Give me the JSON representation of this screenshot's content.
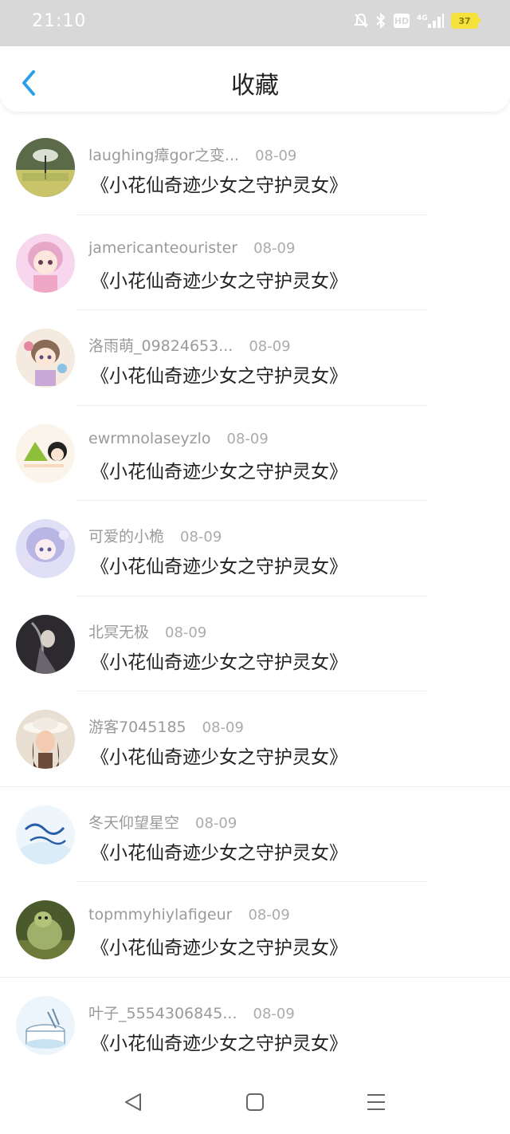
{
  "status_bar": {
    "time": "21:10",
    "network": "4G",
    "hd": "HD",
    "battery": "37",
    "icons": [
      "mute-bell-icon",
      "bluetooth-icon",
      "hd-icon",
      "signal-icon",
      "battery-icon"
    ]
  },
  "header": {
    "title": "收藏",
    "back_icon": "chevron-left-icon",
    "accent": "#2aa0e6"
  },
  "favorites": [
    {
      "user": "laughing瘴gor之变...",
      "date": "08-09",
      "title": "《小花仙奇迹少女之守护灵女》",
      "avatar": "girl-umbrella-photo"
    },
    {
      "user": "jamericanteourister",
      "date": "08-09",
      "title": "《小花仙奇迹少女之守护灵女》",
      "avatar": "pink-anime-girl"
    },
    {
      "user": "洛雨萌_09824653...",
      "date": "08-09",
      "title": "《小花仙奇迹少女之守护灵女》",
      "avatar": "anime-girl-sweets"
    },
    {
      "user": "ewrmnolaseyzlo",
      "date": "08-09",
      "title": "《小花仙奇迹少女之守护灵女》",
      "avatar": "cartoon-zongzi-couple"
    },
    {
      "user": "可爱的小桅",
      "date": "08-09",
      "title": "《小花仙奇迹少女之守护灵女》",
      "avatar": "purple-anime-girl"
    },
    {
      "user": "北冥无极",
      "date": "08-09",
      "title": "《小花仙奇迹少女之守护灵女》",
      "avatar": "dark-ink-warrior"
    },
    {
      "user": "游客7045185",
      "date": "08-09",
      "title": "《小花仙奇迹少女之守护灵女》",
      "avatar": "girl-with-hat-photo"
    },
    {
      "user": "冬天仰望星空",
      "date": "08-09",
      "title": "《小花仙奇迹少女之守护灵女》",
      "avatar": "blue-calligraphy"
    },
    {
      "user": "topmmyhiylafigeur",
      "date": "08-09",
      "title": "《小花仙奇迹少女之守护灵女》",
      "avatar": "green-ogre"
    },
    {
      "user": "叶子_5554306845...",
      "date": "08-09",
      "title": "《小花仙奇迹少女之守护灵女》",
      "avatar": "cake-sketch"
    }
  ],
  "nav_bar": {
    "back": "triangle-back-icon",
    "home": "square-home-icon",
    "menu": "hamburger-menu-icon"
  }
}
